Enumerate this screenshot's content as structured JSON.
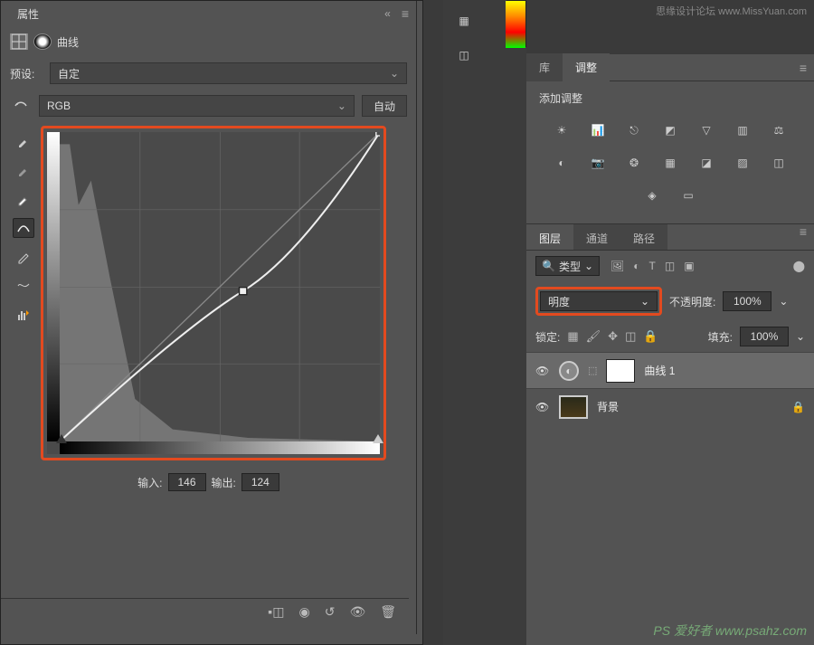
{
  "watermark_top": "思缘设计论坛 www.MissYuan.com",
  "watermark_bottom": "PS 爱好者 www.psahz.com",
  "properties": {
    "panel_title": "属性",
    "curves_label": "曲线",
    "preset_label": "预设:",
    "preset_value": "自定",
    "channel_value": "RGB",
    "auto_btn": "自动",
    "input_label": "输入:",
    "input_value": "146",
    "output_label": "输出:",
    "output_value": "124"
  },
  "adjustments": {
    "lib_tab": "库",
    "adj_tab": "调整",
    "title": "添加调整"
  },
  "layers": {
    "layers_tab": "图层",
    "channels_tab": "通道",
    "paths_tab": "路径",
    "kind_label": "类型",
    "blend_value": "明度",
    "opacity_label": "不透明度:",
    "opacity_value": "100%",
    "lock_label": "锁定:",
    "fill_label": "填充:",
    "fill_value": "100%",
    "layer1_name": "曲线 1",
    "layer2_name": "背景"
  },
  "chart_data": {
    "type": "line",
    "title": "曲线 (Curves)",
    "xlabel": "输入",
    "ylabel": "输出",
    "xlim": [
      0,
      255
    ],
    "ylim": [
      0,
      255
    ],
    "series": [
      {
        "name": "baseline",
        "x": [
          0,
          255
        ],
        "y": [
          0,
          255
        ]
      },
      {
        "name": "curve",
        "x": [
          0,
          146,
          255
        ],
        "y": [
          0,
          124,
          255
        ]
      }
    ],
    "control_points": [
      {
        "input": 0,
        "output": 0
      },
      {
        "input": 146,
        "output": 124
      },
      {
        "input": 255,
        "output": 255
      }
    ],
    "histogram_note": "background histogram heavily weighted to shadows (left side)"
  }
}
